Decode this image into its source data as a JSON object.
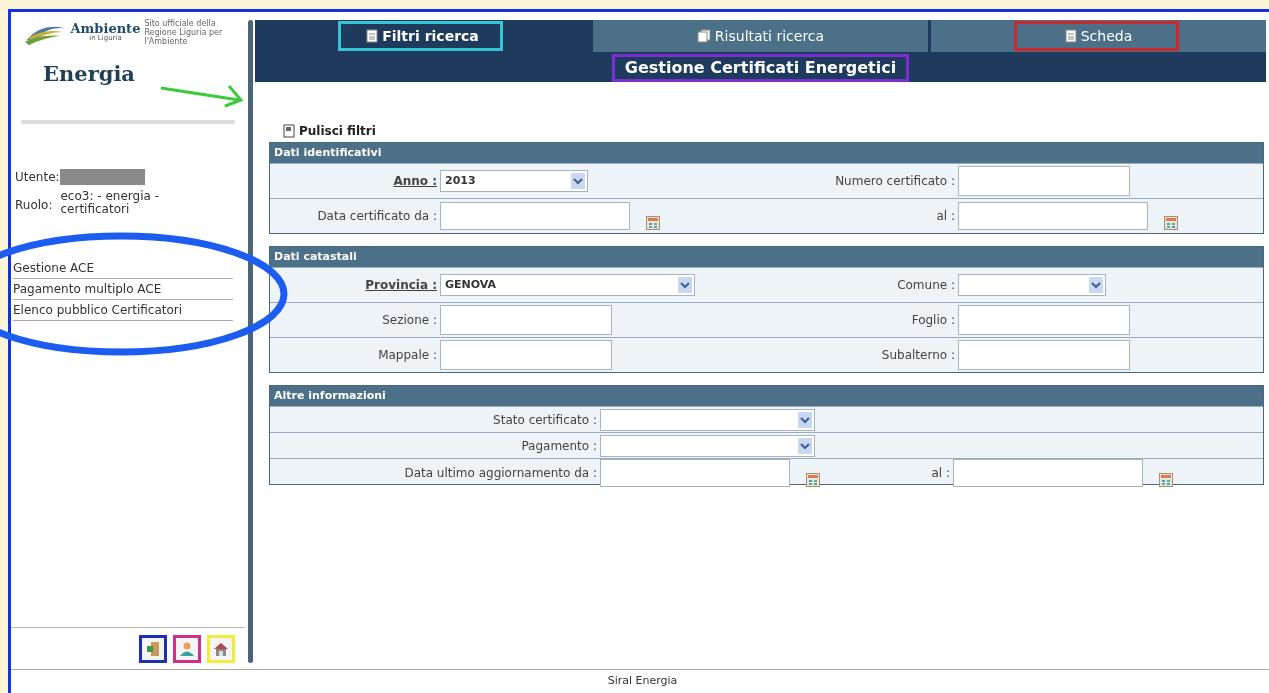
{
  "sidebar": {
    "logo_title": "Ambiente",
    "logo_subtitle": "in Liguria",
    "logo_note": "Sito ufficiale della Regione Liguria per l'Ambiente",
    "app_name": "Energia",
    "user_label": "Utente:",
    "role_label": "Ruolo:",
    "role_value": "eco3: - energia - certificatori",
    "menu": [
      {
        "label": "Gestione ACE"
      },
      {
        "label": "Pagamento multiplo ACE"
      },
      {
        "label": "Elenco pubblico Certificatori"
      }
    ],
    "tools": [
      {
        "kind": "exit",
        "color": "#1f2fb5"
      },
      {
        "kind": "user",
        "color": "#d0308a"
      },
      {
        "kind": "home",
        "color": "#f2ec3a"
      }
    ]
  },
  "tabs": [
    {
      "label": "Filtri ricerca",
      "selected": true,
      "kind": "page",
      "color": "#35c6d6"
    },
    {
      "label": "Risultati ricerca",
      "selected": false,
      "kind": "pages"
    },
    {
      "label": "Scheda",
      "selected": false,
      "kind": "page",
      "color": "#cc2a2a"
    }
  ],
  "page_title": "Gestione Certificati Energetici",
  "clear_filters": "Pulisci filtri",
  "sections": [
    {
      "title": "Dati identificativi",
      "kind": "pairs",
      "rows": [
        [
          {
            "label": "Anno :",
            "kind": "select",
            "value": "2013",
            "underline": true
          },
          {
            "label": "Numero certificato :",
            "kind": "text",
            "underline": false
          }
        ],
        [
          {
            "label": "Data certificato da :",
            "kind": "date",
            "underline": false
          },
          {
            "label": "al :",
            "kind": "date",
            "underline": false
          }
        ]
      ]
    },
    {
      "title": "Dati catastali",
      "kind": "pairs",
      "rows": [
        [
          {
            "label": "Provincia :",
            "kind": "select",
            "value": "GENOVA",
            "underline": true
          },
          {
            "label": "Comune :",
            "kind": "select",
            "underline": false
          }
        ],
        [
          {
            "label": "Sezione :",
            "kind": "text",
            "underline": false
          },
          {
            "label": "Foglio :",
            "kind": "text",
            "underline": false
          }
        ],
        [
          {
            "label": "Mappale :",
            "kind": "text",
            "underline": false
          },
          {
            "label": "Subalterno :",
            "kind": "text",
            "underline": false
          }
        ]
      ]
    },
    {
      "title": "Altre informazioni",
      "kind": "wide",
      "rows": [
        [
          {
            "label": "Stato certificato :",
            "kind": "select",
            "underline": false
          }
        ],
        [
          {
            "label": "Pagamento :",
            "kind": "select",
            "underline": false
          }
        ],
        [
          {
            "label": "Data ultimo aggiornamento da :",
            "kind": "date",
            "underline": false
          },
          {
            "label": "al :",
            "kind": "date",
            "underline": false
          }
        ]
      ]
    }
  ],
  "footer": "Siral Energia"
}
